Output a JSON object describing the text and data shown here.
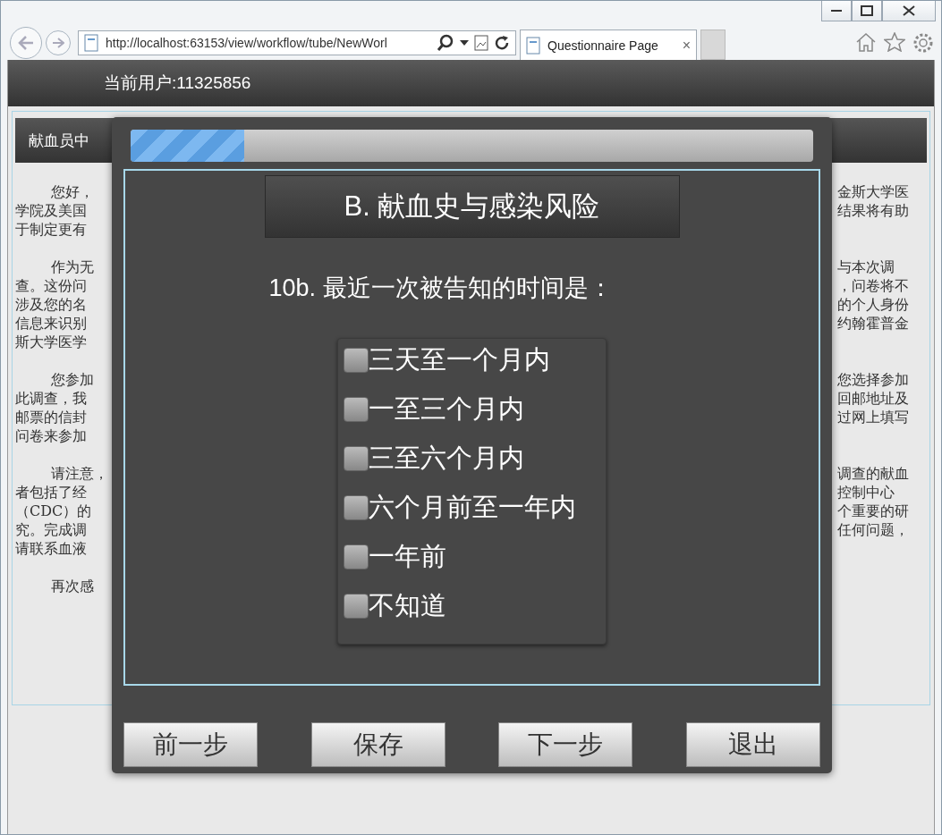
{
  "browser": {
    "address": "http://localhost:63153/view/workflow/tube/NewWorl",
    "tabs": [
      {
        "label": "Questionnaire Page",
        "close": "×",
        "selected": true
      }
    ]
  },
  "header": {
    "user_label": "当前用户:11325856"
  },
  "page": {
    "section_title": "献血员中",
    "paragraphs": [
      {
        "lines": [
          {
            "left": "您好，",
            "right": "金斯大学医"
          },
          {
            "left": "学院及美国",
            "right": "结果将有助"
          },
          {
            "left": "于制定更有"
          }
        ]
      },
      {
        "lines": [
          {
            "left": "作为无",
            "right": "与本次调"
          },
          {
            "left": "查。这份问",
            "right": "，问卷将不"
          },
          {
            "left": "涉及您的名",
            "right": "的个人身份"
          },
          {
            "left": "信息来识别",
            "right": "约翰霍普金"
          },
          {
            "left": "斯大学医学"
          }
        ]
      },
      {
        "lines": [
          {
            "left": "您参加",
            "right": "您选择参加"
          },
          {
            "left": "此调查，我",
            "right": "回邮地址及"
          },
          {
            "left": "邮票的信封",
            "right": "过网上填写"
          },
          {
            "left": "问卷来参加"
          }
        ]
      },
      {
        "lines": [
          {
            "left": "请注意，",
            "right": "调查的献血"
          },
          {
            "left": "者包括了经",
            "right": "控制中心"
          },
          {
            "left": "（CDC）的",
            "right": "个重要的研"
          },
          {
            "left": "究。完成调",
            "right": "任何问题，"
          },
          {
            "left": "请联系血液"
          }
        ]
      },
      {
        "lines": [
          {
            "left": "再次感"
          }
        ]
      }
    ]
  },
  "dialog": {
    "progress": {
      "level": 0.166
    },
    "section_title": "B. 献血史与感染风险",
    "question": "10b. 最近一次被告知的时间是：",
    "options": [
      {
        "label": "三天至一个月内",
        "checked": false
      },
      {
        "label": "一至三个月内",
        "checked": false
      },
      {
        "label": "三至六个月内",
        "checked": false
      },
      {
        "label": "六个月前至一年内",
        "checked": false
      },
      {
        "label": "一年前",
        "checked": false
      },
      {
        "label": "不知道",
        "checked": false
      }
    ],
    "buttons": [
      "前一步",
      "保存",
      "下一步",
      "退出"
    ]
  }
}
